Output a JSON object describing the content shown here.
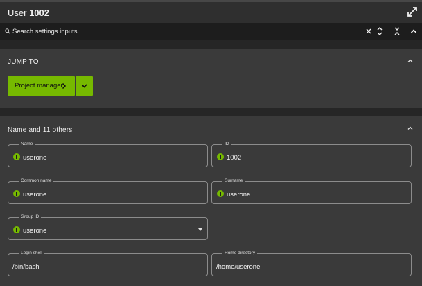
{
  "window": {
    "title_prefix": "User",
    "title_id": "1002",
    "expand_icon": "expand-icon"
  },
  "search": {
    "placeholder": "Search settings inputs",
    "value": "",
    "buttons": [
      "clear-icon",
      "chevron-up-down-icon",
      "collapse-all-icon",
      "chevron-up-icon"
    ]
  },
  "jump_to": {
    "heading": "JUMP TO",
    "primary_button": "Project manager",
    "dropdown_icon": "chevron-down-icon"
  },
  "section": {
    "heading": "Name and 11 others",
    "fields": [
      {
        "label": "Name",
        "value": "userone",
        "icon": "info-icon"
      },
      {
        "label": "ID",
        "value": "1002",
        "icon": "info-icon"
      },
      {
        "label": "Common name",
        "value": "userone",
        "icon": "info-icon"
      },
      {
        "label": "Surname",
        "value": "userone",
        "icon": "info-icon"
      },
      {
        "label": "Group ID",
        "value": "userone",
        "icon": "info-icon",
        "type": "select"
      },
      {
        "label": "Login shell",
        "value": "/bin/bash"
      },
      {
        "label": "Home directory",
        "value": "/home/userone"
      }
    ]
  },
  "colors": {
    "accent": "#76b900",
    "panel": "#3a3a3a",
    "header": "#2f2f2f",
    "search_bg": "#1d1d1d"
  }
}
